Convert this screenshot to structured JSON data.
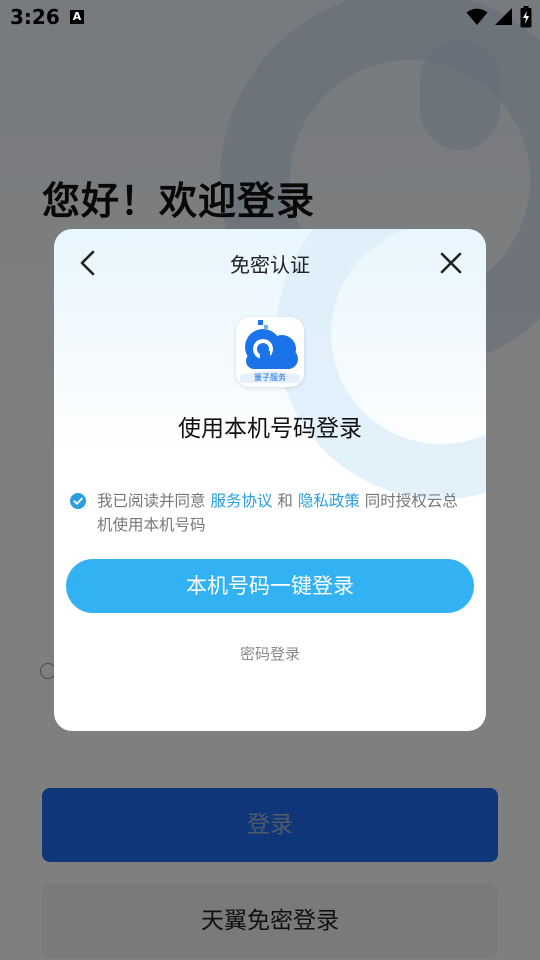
{
  "status_bar": {
    "time": "3:26",
    "notification_icon": "A"
  },
  "background_page": {
    "greeting": "您好！欢迎登录",
    "login_button": "登录",
    "tianyi_button": "天翼免密登录"
  },
  "dialog": {
    "title": "免密认证",
    "back_icon": "chevron-left-icon",
    "close_icon": "close-icon",
    "logo_tag": "量子服务",
    "subtitle": "使用本机号码登录",
    "agreement": {
      "checked": true,
      "prefix": "我已阅读并同意 ",
      "link1": "服务协议",
      "middle": " 和 ",
      "link2": "隐私政策",
      "suffix": " 同时授权云总机使用本机号码"
    },
    "one_click_button": "本机号码一键登录",
    "password_login": "密码登录"
  },
  "colors": {
    "accent": "#33b2f3",
    "link": "#2a9fe0",
    "primary_blue": "#1f6df2"
  }
}
